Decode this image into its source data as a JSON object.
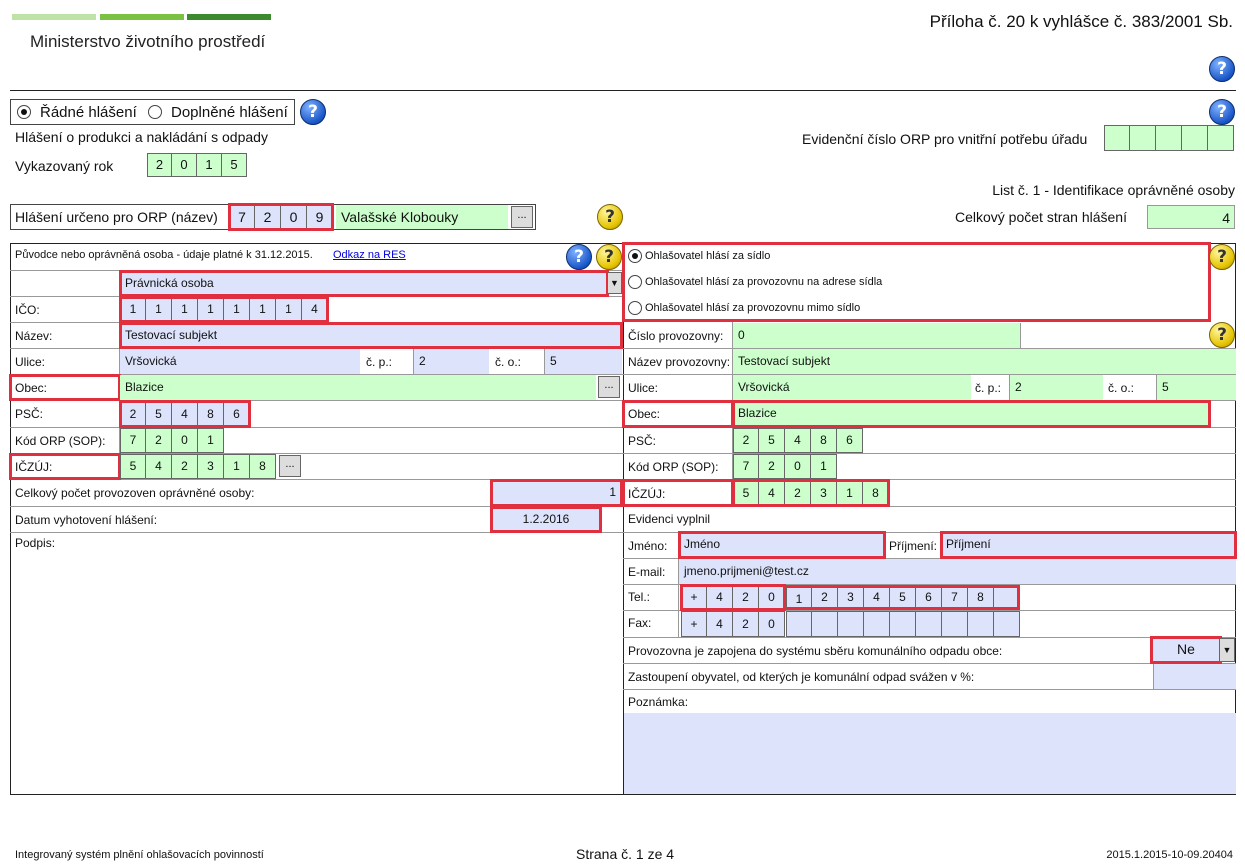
{
  "header": {
    "ministry": "Ministerstvo životního prostředí",
    "annex": "Příloha č. 20 k vyhlášce č. 383/2001 Sb."
  },
  "report_type": {
    "option1": "Řádné hlášení",
    "option2": "Doplněné hlášení",
    "selected": "option1"
  },
  "subtitle": "Hlášení o produkci a nakládání s odpady",
  "year": {
    "label": "Vykazovaný rok",
    "digits": [
      "2",
      "0",
      "1",
      "5"
    ]
  },
  "evid": {
    "label": "Evidenční číslo ORP pro vnitřní potřebu úřadu"
  },
  "sheet_label": "List č. 1 - Identifikace oprávněné osoby",
  "orp": {
    "label": "Hlášení určeno pro ORP (název)",
    "digits": [
      "7",
      "2",
      "0",
      "9"
    ],
    "name": "Valašské Klobouky",
    "browse": "..."
  },
  "pages": {
    "label": "Celkový počet stran hlášení",
    "value": "4"
  },
  "left": {
    "section_title": "Původce nebo oprávněná osoba - údaje platné k 31.12.2015.",
    "res_link": "Odkaz na RES",
    "person_type": "Právnická osoba",
    "ico_label": "IČO:",
    "ico_digits": [
      "1",
      "1",
      "1",
      "1",
      "1",
      "1",
      "1",
      "4"
    ],
    "name_label": "Název:",
    "name_value": "Testovací subjekt",
    "street_label": "Ulice:",
    "street_value": "Vršovická",
    "cp_label": "č. p.:",
    "cp_value": "2",
    "co_label": "č. o.:",
    "co_value": "5",
    "city_label": "Obec:",
    "city_value": "Blazice",
    "psc_label": "PSČ:",
    "psc_digits": [
      "2",
      "5",
      "4",
      "8",
      "6"
    ],
    "orp_label": "Kód ORP (SOP):",
    "orp_digits": [
      "7",
      "2",
      "0",
      "1"
    ],
    "iczuj_label": "IČZÚJ:",
    "iczuj_digits": [
      "5",
      "4",
      "2",
      "3",
      "1",
      "8"
    ],
    "total_label": "Celkový počet provozoven oprávněné osoby:",
    "total_value": "1",
    "date_label": "Datum vyhotovení hlášení:",
    "date_value": "1.2.2016",
    "signature_label": "Podpis:"
  },
  "right": {
    "radio1": "Ohlašovatel hlásí za sídlo",
    "radio2": "Ohlašovatel hlásí za provozovnu na adrese sídla",
    "radio3": "Ohlašovatel hlásí za provozovnu mimo sídlo",
    "selected": "radio1",
    "prov_no_label": "Číslo provozovny:",
    "prov_no_value": "0",
    "prov_name_label": "Název provozovny:",
    "prov_name_value": "Testovací subjekt",
    "street_label": "Ulice:",
    "street_value": "Vršovická",
    "cp_label": "č. p.:",
    "cp_value": "2",
    "co_label": "č. o.:",
    "co_value": "5",
    "city_label": "Obec:",
    "city_value": "Blazice",
    "psc_label": "PSČ:",
    "psc_digits": [
      "2",
      "5",
      "4",
      "8",
      "6"
    ],
    "orp_label": "Kód ORP (SOP):",
    "orp_digits": [
      "7",
      "2",
      "0",
      "1"
    ],
    "iczuj_label": "IČZÚJ:",
    "iczuj_digits": [
      "5",
      "4",
      "2",
      "3",
      "1",
      "8"
    ],
    "filled_by_label": "Evidenci vyplnil",
    "first_name_label": "Jméno:",
    "first_name_value": "Jméno",
    "last_name_label": "Příjmení:",
    "last_name_value": "Příjmení",
    "email_label": "E-mail:",
    "email_value": "jmeno.prijmeni@test.cz",
    "tel_label": "Tel.:",
    "tel_prefix": [
      "+",
      "4",
      "2",
      "0"
    ],
    "tel_digits": [
      "1",
      "2",
      "3",
      "4",
      "5",
      "6",
      "7",
      "8",
      ""
    ],
    "fax_label": "Fax:",
    "fax_prefix": [
      "+",
      "4",
      "2",
      "0"
    ],
    "fax_digits": [
      "",
      "",
      "",
      "",
      "",
      "",
      "",
      "",
      ""
    ],
    "waste_label": "Provozovna je zapojena do systému sběru komunálního odpadu obce:",
    "waste_value": "Ne",
    "pop_label": "Zastoupení obyvatel, od kterých je komunální odpad svážen v %:",
    "note_label": "Poznámka:"
  },
  "footer": {
    "left": "Integrovaný systém plnění ohlašovacích povinností",
    "center": "Strana č. 1 ze 4",
    "right": "2015.1.2015-10-09.20404"
  }
}
